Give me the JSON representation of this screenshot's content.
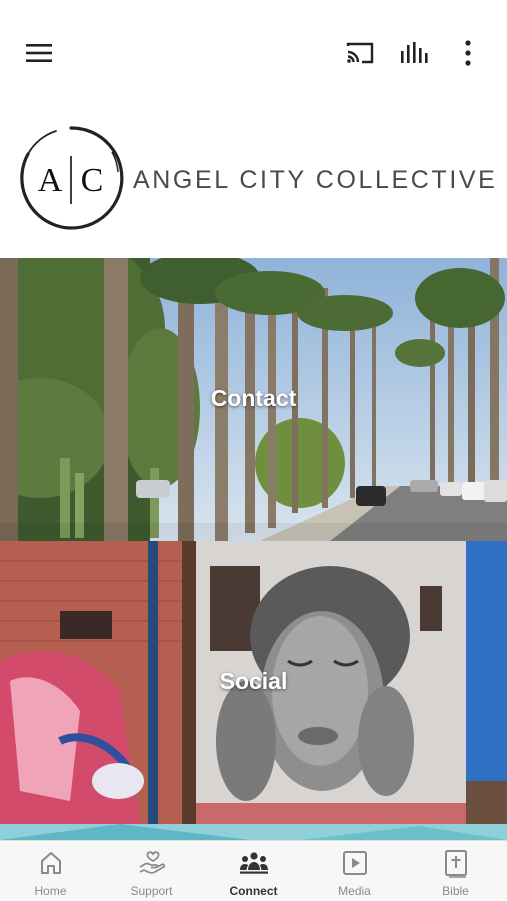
{
  "status_bar": {
    "time": ""
  },
  "app_bar": {
    "menu_icon": "hamburger-menu-icon",
    "cast_icon": "cast-icon",
    "audio_icon": "audio-bars-icon",
    "more_icon": "more-vertical-icon"
  },
  "logo": {
    "monogram_left": "A",
    "monogram_right": "C",
    "brand_name": "ANGEL CITY COLLECTIVE"
  },
  "tiles": [
    {
      "label": "Contact",
      "image": "palm-tree-street-photo"
    },
    {
      "label": "Social",
      "image": "graffiti-mural-photo"
    }
  ],
  "tab_bar": {
    "active": "Connect",
    "items": [
      {
        "label": "Home",
        "icon": "home-icon"
      },
      {
        "label": "Support",
        "icon": "support-hand-heart-icon"
      },
      {
        "label": "Connect",
        "icon": "people-group-icon"
      },
      {
        "label": "Media",
        "icon": "media-play-icon"
      },
      {
        "label": "Bible",
        "icon": "bible-icon"
      }
    ]
  },
  "colors": {
    "active_tab": "#333333",
    "inactive_tab": "#8a8a8a",
    "tab_bar_bg": "#f7f7f7",
    "brand_text": "#4a4a4a"
  }
}
